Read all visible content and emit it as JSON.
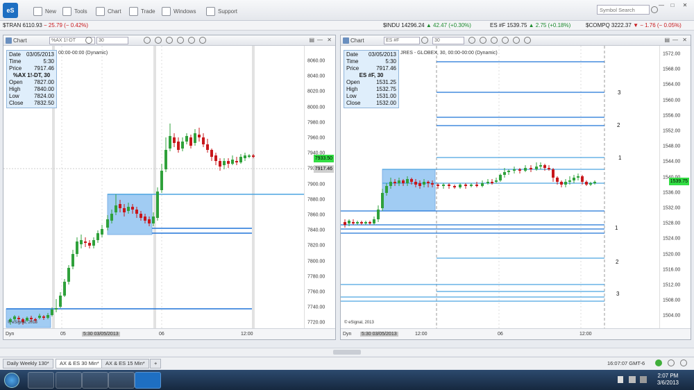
{
  "toolbar": {
    "app_logo": "eS",
    "items": [
      {
        "label": "New",
        "icon": "new-file-icon"
      },
      {
        "label": "Tools",
        "icon": "tools-icon"
      },
      {
        "label": "Chart",
        "icon": "chart-icon"
      },
      {
        "label": "Trade",
        "icon": "trade-icon"
      },
      {
        "label": "Windows",
        "icon": "windows-icon"
      },
      {
        "label": "Support",
        "icon": "support-icon"
      }
    ],
    "symbol_search_placeholder": "Symbol Search"
  },
  "ticker": [
    {
      "symbol": "$TRAN",
      "price": "6110.93",
      "change": "− 25.79 (− 0.42%)",
      "dir": "dn"
    },
    {
      "symbol": "$INDU",
      "price": "14296.24",
      "change": "▲ 42.47 (+0.30%)",
      "dir": "up"
    },
    {
      "symbol": "ES #F",
      "price": "1539.75",
      "change": "▲ 2.75 (+0.18%)",
      "dir": "up"
    },
    {
      "symbol": "$COMPQ",
      "price": "3222.37",
      "change": "▼ − 1.76 (− 0.05%)",
      "dir": "dn"
    }
  ],
  "left_chart": {
    "title": "Chart",
    "symbol": "%AX 1!-DT",
    "interval": "30",
    "header_text": "00:00-00:00 (Dynamic)",
    "databox": {
      "date_label": "Date",
      "date": "03/05/2013",
      "time_label": "Time",
      "time": "5:30",
      "price_label": "Price",
      "price": "7917.46",
      "symbol": "%AX 1!-DT, 30",
      "open_label": "Open",
      "open": "7827.00",
      "high_label": "High",
      "high": "7840.00",
      "low_label": "Low",
      "low": "7824.00",
      "close_label": "Close",
      "close": "7832.50"
    },
    "y_ticks": [
      "8060.00",
      "8040.00",
      "8020.00",
      "8000.00",
      "7980.00",
      "7960.00",
      "7940.00",
      "7920.00",
      "7900.00",
      "7880.00",
      "7860.00",
      "7840.00",
      "7820.00",
      "7800.00",
      "7780.00",
      "7760.00",
      "7740.00",
      "7720.00"
    ],
    "last_price": "7933.50",
    "crosshair_price": "7917.46",
    "x_labels": [
      "05",
      "06",
      "12:00"
    ],
    "cursor_label": "5:30 03/05/2013",
    "dyn_label": "Dyn",
    "watermark": "© eSignal, 2013",
    "colors": {
      "up": "#2fa13b",
      "down": "#c8171b",
      "zone": "#7ab7ef",
      "line": "#1e73d8",
      "flag": "#33dd44"
    }
  },
  "right_chart": {
    "title": "Chart",
    "symbol": "ES #F",
    "interval": "30",
    "header_text": "JRES - GLOBEX, 30, 00:00-00:00 (Dynamic)",
    "databox": {
      "date_label": "Date",
      "date": "03/05/2013",
      "time_label": "Time",
      "time": "5:30",
      "price_label": "Price",
      "price": "7917.46",
      "symbol": "ES #F, 30",
      "open_label": "Open",
      "open": "1531.25",
      "high_label": "High",
      "high": "1532.75",
      "low_label": "Low",
      "low": "1531.00",
      "close_label": "Close",
      "close": "1532.00"
    },
    "y_ticks": [
      "1572.00",
      "1568.00",
      "1564.00",
      "1560.00",
      "1556.00",
      "1552.00",
      "1548.00",
      "1544.00",
      "1540.00",
      "1536.00",
      "1532.00",
      "1528.00",
      "1524.00",
      "1520.00",
      "1516.00",
      "1512.00",
      "1508.00",
      "1504.00"
    ],
    "last_price": "1539.75",
    "zone_labels": [
      "3",
      "2",
      "1",
      "1",
      "2",
      "3"
    ],
    "x_labels": [
      "12:00",
      "06",
      "12:00"
    ],
    "cursor_label": "5:30 03/05/2013",
    "dyn_label": "Dyn",
    "watermark": "© eSignal, 2013"
  },
  "tabs": [
    {
      "label": "Daily Weekly 130*",
      "active": false
    },
    {
      "label": "AX & ES 30 Min*",
      "active": true
    },
    {
      "label": "AX & ES 15 Min*",
      "active": false
    },
    {
      "label": "+",
      "active": false
    }
  ],
  "status_time": "16:07:07 GMT-6",
  "clock": {
    "time": "2:07 PM",
    "date": "3/6/2013"
  }
}
